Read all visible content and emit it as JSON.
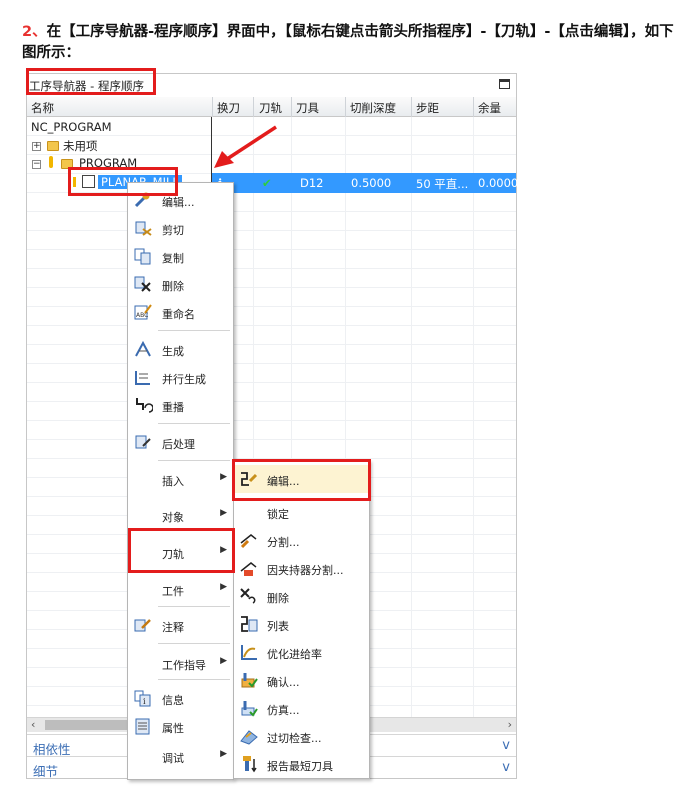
{
  "instruction": {
    "number": "2、",
    "text": "在【工序导航器-程序顺序】界面中，【鼠标右键点击箭头所指程序】-【刀轨】-【点击编辑】，如下图所示："
  },
  "navigator": {
    "title": "工序导航器 - 程序顺序",
    "columns": [
      "名称",
      "换刀",
      "刀轨",
      "刀具",
      "切削深度",
      "步距",
      "余量"
    ],
    "tree": {
      "root": "NC_PROGRAM",
      "unused": "未用项",
      "program": "PROGRAM",
      "operation": "PLANAR_MILL"
    },
    "selected_row": {
      "tool": "D12",
      "cut_depth": "0.5000",
      "stepover": "50 平直...",
      "stock": "0.0000"
    },
    "panels": [
      "相依性",
      "细节"
    ]
  },
  "context_menu": {
    "items": [
      {
        "label": "编辑...",
        "icon": "wrench-icon"
      },
      {
        "label": "剪切",
        "icon": "cut-icon"
      },
      {
        "label": "复制",
        "icon": "copy-icon"
      },
      {
        "label": "删除",
        "icon": "delete-icon"
      },
      {
        "label": "重命名",
        "icon": "rename-icon"
      },
      {
        "label": "生成",
        "icon": "generate-icon"
      },
      {
        "label": "并行生成",
        "icon": "parallel-generate-icon"
      },
      {
        "label": "重播",
        "icon": "replay-icon"
      },
      {
        "label": "后处理",
        "icon": "postprocess-icon"
      },
      {
        "label": "插入"
      },
      {
        "label": "对象"
      },
      {
        "label": "刀轨"
      },
      {
        "label": "工件"
      },
      {
        "label": "注释",
        "icon": "note-icon"
      },
      {
        "label": "工作指导"
      },
      {
        "label": "信息",
        "icon": "info-icon"
      },
      {
        "label": "属性",
        "icon": "properties-icon"
      },
      {
        "label": "调试"
      }
    ]
  },
  "toolpath_submenu": {
    "items": [
      {
        "label": "编辑...",
        "icon": "edit-path-icon"
      },
      {
        "label": "锁定"
      },
      {
        "label": "分割...",
        "icon": "split-icon"
      },
      {
        "label": "因夹持器分割...",
        "icon": "holder-split-icon"
      },
      {
        "label": "删除",
        "icon": "delete-path-icon"
      },
      {
        "label": "列表",
        "icon": "list-icon"
      },
      {
        "label": "优化进给率",
        "icon": "feedrate-icon"
      },
      {
        "label": "确认...",
        "icon": "verify-icon"
      },
      {
        "label": "仿真...",
        "icon": "simulate-icon"
      },
      {
        "label": "过切检查...",
        "icon": "gouge-check-icon"
      },
      {
        "label": "报告最短刀具",
        "icon": "shortest-tool-icon"
      }
    ]
  },
  "colors": {
    "highlight_red": "#e31c1c",
    "selection_blue": "#3399ff",
    "panel_link": "#3d6fb5"
  }
}
